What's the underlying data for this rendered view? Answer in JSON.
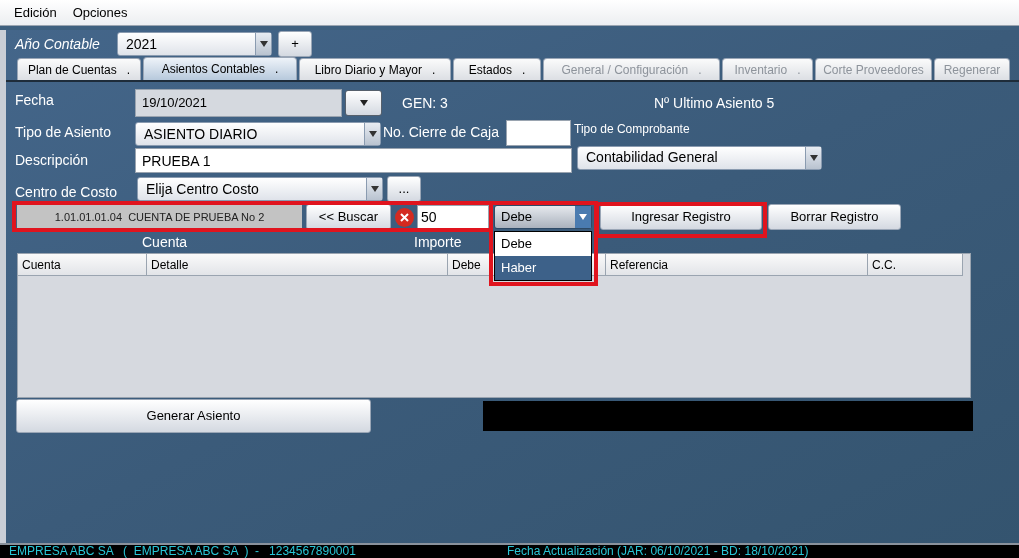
{
  "menu": [
    "Edición",
    "Opciones"
  ],
  "year": {
    "label": "Año Contable",
    "value": "2021",
    "add_button": "+"
  },
  "tabs": [
    {
      "label": "Plan de Cuentas",
      "mark": ".",
      "selected": false,
      "disabled": false
    },
    {
      "label": "Asientos Contables",
      "mark": ".",
      "selected": true,
      "disabled": false
    },
    {
      "label": "Libro Diario y Mayor",
      "mark": ".",
      "selected": false,
      "disabled": false
    },
    {
      "label": "Estados",
      "mark": ".",
      "selected": false,
      "disabled": false
    },
    {
      "label": "General / Configuración",
      "mark": ".",
      "selected": false,
      "disabled": true
    },
    {
      "label": "Inventario",
      "mark": ".",
      "selected": false,
      "disabled": true
    },
    {
      "label": "Corte Proveedores",
      "selected": false,
      "disabled": true
    },
    {
      "label": "Regenerar",
      "selected": false,
      "disabled": true
    }
  ],
  "fecha": {
    "label": "Fecha",
    "value": "19/10/2021"
  },
  "gen": "GEN: 3",
  "ultimo_asiento": "Nº Ultimo Asiento 5",
  "tipo_asiento": {
    "label": "Tipo de Asiento",
    "value": "ASIENTO DIARIO"
  },
  "cierre_caja": {
    "label": "No. Cierre de Caja"
  },
  "tipo_comprobante": {
    "label": "Tipo de Comprobante",
    "value": "Contabilidad General"
  },
  "descripcion": {
    "label": "Descripción",
    "value": "PRUEBA 1"
  },
  "centro_costo": {
    "label": "Centro de Costo",
    "value": "Elija Centro Costo",
    "button": "..."
  },
  "entry": {
    "highlighted": true,
    "account": "1.01.01.01.04  CUENTA DE PRUEBA No 2",
    "search_button": "<< Buscar",
    "amount": "50",
    "side": {
      "value": "Debe",
      "expanded": true,
      "highlighted": true,
      "options": [
        {
          "label": "Debe",
          "highlighted": false
        },
        {
          "label": "Haber",
          "highlighted": true
        }
      ]
    },
    "buttons": [
      {
        "label": "Ingresar Registro",
        "highlighted": true
      },
      {
        "label": "Borrar Registro",
        "highlighted": false
      }
    ],
    "captions": [
      "Cuenta",
      "Importe"
    ]
  },
  "table": {
    "columns": [
      "Cuenta",
      "Detalle",
      "Debe",
      "Referencia",
      "C.C."
    ]
  },
  "generate_button": "Generar Asiento",
  "status_bar": {
    "left": "EMPRESA ABC SA   (  EMPRESA ABC SA  )  -   1234567890001",
    "right": "Fecha Actualización (JAR: 06/10/2021 - BD: 18/10/2021)"
  }
}
